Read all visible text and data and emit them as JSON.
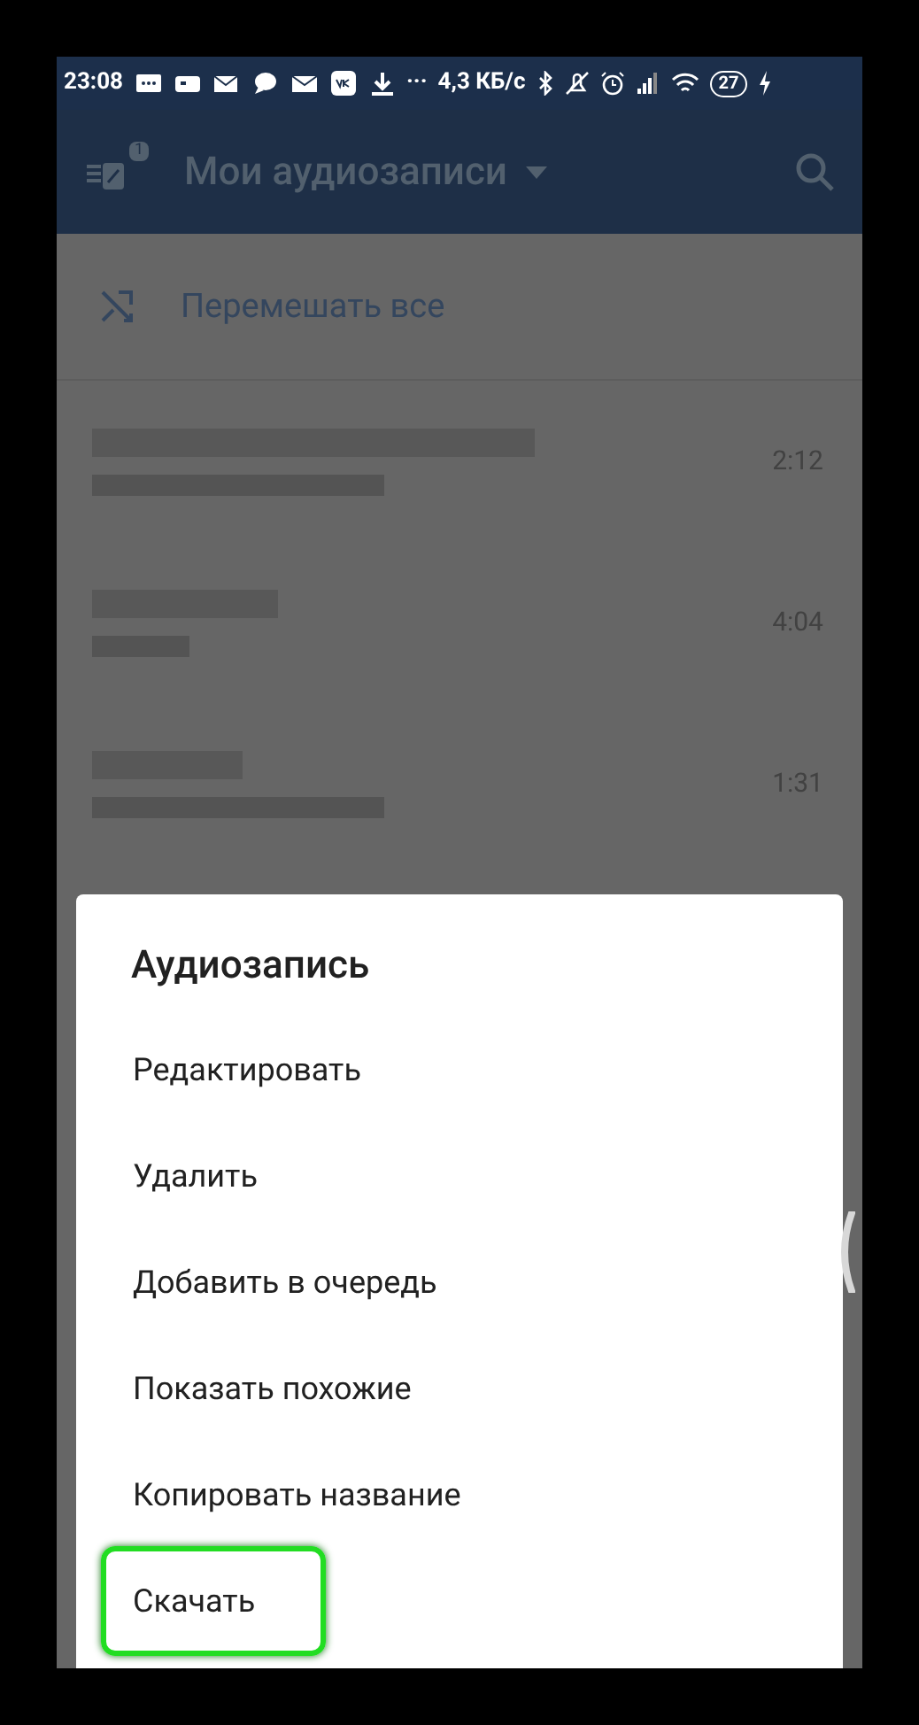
{
  "status_bar": {
    "time": "23:08",
    "more": "···",
    "speed": "4,3 КБ/с",
    "battery": "27"
  },
  "header": {
    "title": "Мои аудиозаписи",
    "badge": "1"
  },
  "shuffle": {
    "label": "Перемешать все"
  },
  "tracks": [
    {
      "duration": "2:12"
    },
    {
      "duration": "4:04"
    },
    {
      "duration": "1:31"
    }
  ],
  "dialog": {
    "title": "Аудиозапись",
    "items": [
      {
        "label": "Редактировать",
        "selected": false
      },
      {
        "label": "Удалить",
        "selected": false
      },
      {
        "label": "Добавить в очередь",
        "selected": false
      },
      {
        "label": "Показать похожие",
        "selected": false
      },
      {
        "label": "Копировать название",
        "selected": false
      },
      {
        "label": "Скачать",
        "selected": true
      }
    ]
  }
}
